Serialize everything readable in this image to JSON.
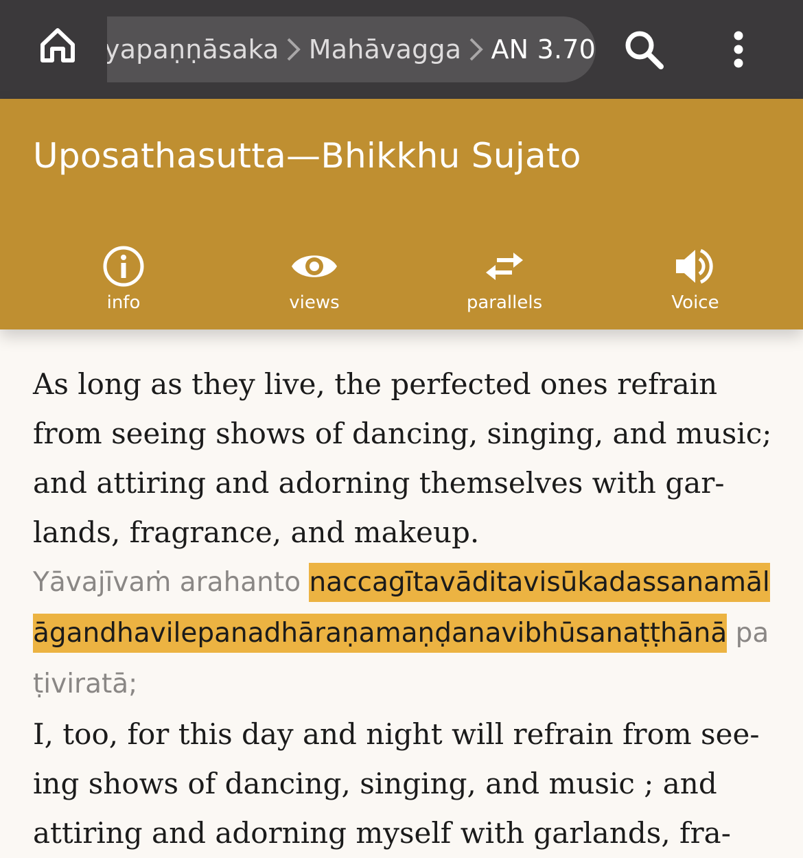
{
  "topbar": {
    "breadcrumbs": [
      "yapaṇṇāsaka",
      "Mahāvagga",
      "AN 3.70"
    ],
    "icons": [
      "home-icon",
      "chevron-right-icon",
      "search-icon",
      "more-vert-icon"
    ]
  },
  "header": {
    "title": "Uposathasutta—Bhikkhu Sujato",
    "actions": [
      {
        "label": "info",
        "icon": "info-circle-icon"
      },
      {
        "label": "views",
        "icon": "eye-icon"
      },
      {
        "label": "parallels",
        "icon": "swap-arrows-icon"
      },
      {
        "label": "Voice",
        "icon": "speaker-icon"
      }
    ]
  },
  "content": {
    "english_1": "As long as they live, the perfected ones refrain from seeing shows of dancing, singing, and music; and attiring and adorning themselves with gar-lands, fragrance, and makeup.",
    "pali_plain": "Yāvajīvaṁ arahanto",
    "pali_highlighted": "naccagītavāditavisūkadassanamālāgandhavilepanadhāraṇamaṇḍanavibhūsanaṭṭhānā",
    "pali_tail": "paṭiviratā;",
    "english_2": "I, too, for this day and night will refrain from see-ing shows of dancing, singing, and music ; and attiring and adorning myself with garlands, fra-"
  },
  "colors": {
    "topbar": "#3b393b",
    "breadcrumb_pill": "#545254",
    "header": "#bf8f31",
    "highlight": "#ecb342",
    "background": "#fbf8f4",
    "pali_text": "#8a8785"
  }
}
